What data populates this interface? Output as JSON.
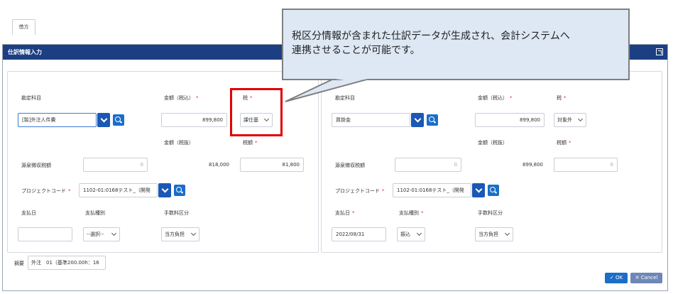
{
  "dialog": {
    "title": "仕訳情報入力",
    "tab_label": "借方",
    "left": {
      "account_label": "勘定科目",
      "account_value": "[製]外注人件費",
      "amount_incl_label": "金額（税込）",
      "amount_incl_value": "899,800",
      "tax_label": "税",
      "tax_value": "課仕基",
      "amount_excl_label": "金額（税抜）",
      "amount_excl_value": "818,000",
      "tax_amount_label": "税額",
      "tax_amount_value": "81,800",
      "withholding_label": "源泉徴収税額",
      "withholding_value": "0",
      "project_label": "プロジェクトコード",
      "project_value": "1102-01:0168テスト_（開発",
      "paydate_label": "支払日",
      "paydate_value": "",
      "paytype_label": "支払種別",
      "paytype_value": "--選択--",
      "fee_label": "手数料区分",
      "fee_value": "当方負担"
    },
    "right": {
      "account_label": "勘定科目",
      "account_value": "買掛金",
      "amount_incl_label": "金額（税込）",
      "amount_incl_value": "899,800",
      "tax_label": "税",
      "tax_value": "対象外",
      "amount_excl_label": "金額（税抜）",
      "amount_excl_value": "899,800",
      "tax_amount_label": "税額",
      "tax_amount_value": "0",
      "withholding_label": "源泉徴収税額",
      "withholding_value": "0",
      "project_label": "プロジェクトコード",
      "project_value": "1102-01:0168テスト_（開発",
      "paydate_label": "支払日",
      "paydate_value": "2022/08/31",
      "paytype_label": "支払種別",
      "paytype_value": "振込",
      "fee_label": "手数料区分",
      "fee_value": "当方負担"
    },
    "summary_label": "摘要",
    "summary_value": "外注　01（基準200.00h：16",
    "ok_label": "OK",
    "cancel_label": "Cancel",
    "required_mark": "*"
  },
  "callout": {
    "line1": "税区分情報が含まれた仕訳データが生成され、会計システムへ",
    "line2": "連携させることが可能です。"
  },
  "colors": {
    "titlebar": "#1b3f82",
    "primary_button": "#1b6ec8",
    "highlight_box": "#e00000",
    "callout_bg": "#dde8f4"
  }
}
